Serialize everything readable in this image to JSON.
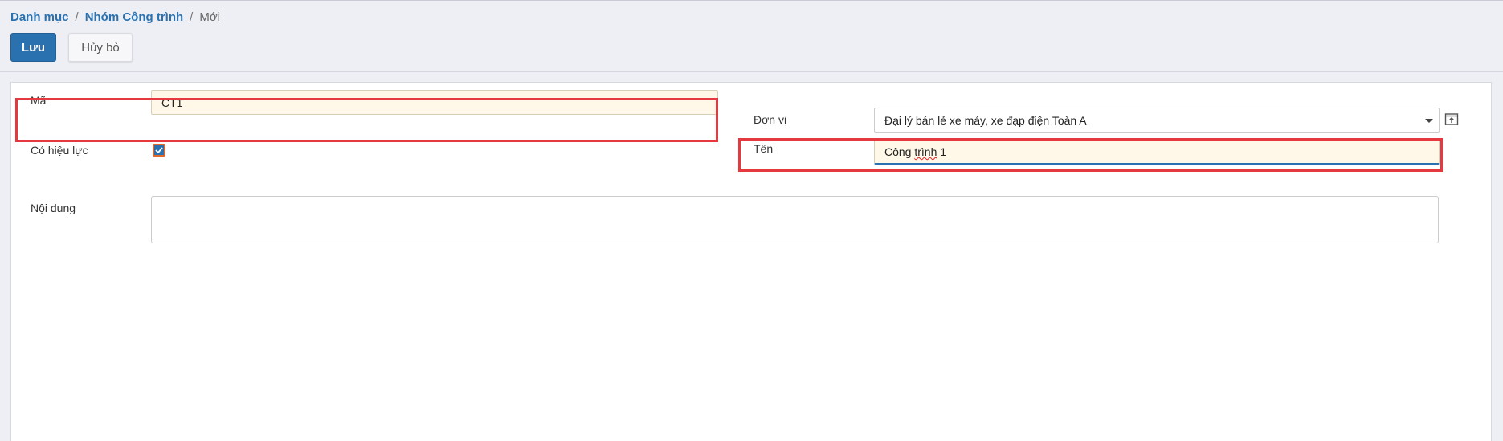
{
  "breadcrumb": {
    "items": [
      "Danh mục",
      "Nhóm Công trình"
    ],
    "current": "Mới",
    "separator": "/"
  },
  "toolbar": {
    "save_label": "Lưu",
    "cancel_label": "Hủy bỏ"
  },
  "form": {
    "ma": {
      "label": "Mã",
      "value": "CT1"
    },
    "co_hieu_luc": {
      "label": "Có hiệu lực",
      "checked": true
    },
    "noi_dung": {
      "label": "Nội dung",
      "value": ""
    },
    "don_vi": {
      "label": "Đơn vị",
      "value": "Đại lý bán lẻ xe máy, xe đạp điện Toàn A"
    },
    "ten": {
      "label": "Tên",
      "value_prefix": "Công ",
      "value_misspelled": "trình",
      "value_suffix": " 1"
    }
  },
  "colors": {
    "accent": "#2a71b0",
    "highlight_box": "#e5393f",
    "required_field_bg": "#fff8e8",
    "background": "#eeeff5"
  },
  "icons": {
    "external": "external-link-icon",
    "dropdown": "chevron-down-icon",
    "check": "check-icon"
  }
}
